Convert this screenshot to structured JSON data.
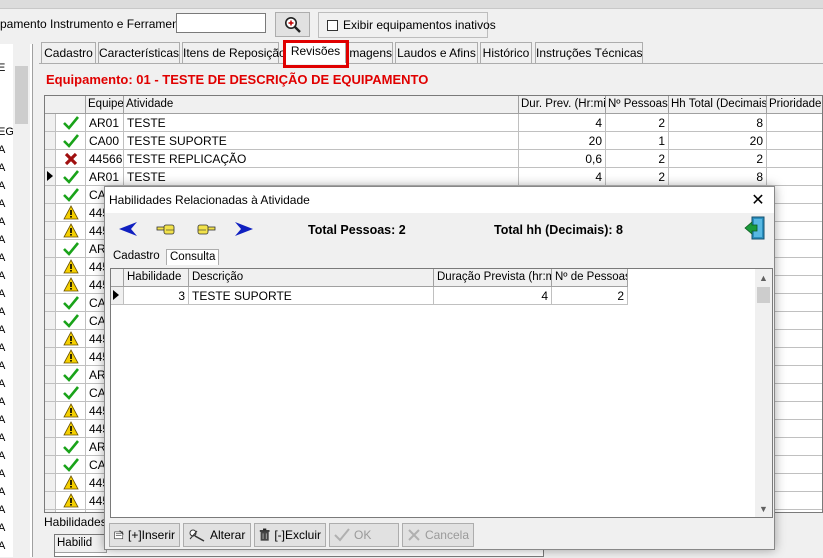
{
  "toolbar": {
    "label": "pamento Instrumento e Ferramenta",
    "search_value": "",
    "inactive_label": "Exibir equipamentos inativos",
    "inactive_checked": false
  },
  "left_tree": {
    "top_letter": "E",
    "letter_eg": "EG",
    "row_letter": "A"
  },
  "tabs": [
    {
      "label": "Cadastro",
      "active": false
    },
    {
      "label": "Características",
      "active": false
    },
    {
      "label": "Itens de Reposição",
      "active": false
    },
    {
      "label": "Revisões",
      "active": true
    },
    {
      "label": "Imagens",
      "active": false
    },
    {
      "label": "Laudos e Afins",
      "active": false
    },
    {
      "label": "Histórico",
      "active": false
    },
    {
      "label": "Instruções Técnicas",
      "active": false
    }
  ],
  "equipment_title": "Equipamento: 01 - TESTE DE DESCRIÇÃO DE EQUIPAMENTO",
  "main_grid": {
    "columns": [
      "Equipe",
      "Atividade",
      "Dur. Prev. (Hr:mi)",
      "Nº Pessoas",
      "Hh Total (Decimais)",
      "Prioridade"
    ],
    "rows": [
      {
        "status": "ok",
        "equipe": "AR01",
        "atividade": "TESTE",
        "dur": "4",
        "pessoas": "2",
        "hh": "8",
        "prioridade": ""
      },
      {
        "status": "ok",
        "equipe": "CA00",
        "atividade": "TESTE SUPORTE",
        "dur": "20",
        "pessoas": "1",
        "hh": "20",
        "prioridade": ""
      },
      {
        "status": "error",
        "equipe": "44566",
        "atividade": "TESTE REPLICAÇÃO",
        "dur": "0,6",
        "pessoas": "2",
        "hh": "2",
        "prioridade": ""
      },
      {
        "status": "ok",
        "equipe": "AR01",
        "atividade": "TESTE",
        "dur": "4",
        "pessoas": "2",
        "hh": "8",
        "prioridade": "",
        "current": true
      },
      {
        "status": "ok",
        "equipe": "CA(",
        "atividade": "",
        "dur": "",
        "pessoas": "",
        "hh": "",
        "prioridade": ""
      },
      {
        "status": "warn",
        "equipe": "445",
        "atividade": "",
        "dur": "",
        "pessoas": "",
        "hh": "",
        "prioridade": ""
      },
      {
        "status": "warn",
        "equipe": "445",
        "atividade": "",
        "dur": "",
        "pessoas": "",
        "hh": "",
        "prioridade": ""
      },
      {
        "status": "ok",
        "equipe": "AR(",
        "atividade": "",
        "dur": "",
        "pessoas": "",
        "hh": "",
        "prioridade": ""
      },
      {
        "status": "warn",
        "equipe": "445",
        "atividade": "",
        "dur": "",
        "pessoas": "",
        "hh": "",
        "prioridade": ""
      },
      {
        "status": "warn",
        "equipe": "445",
        "atividade": "",
        "dur": "",
        "pessoas": "",
        "hh": "",
        "prioridade": ""
      },
      {
        "status": "ok",
        "equipe": "CA(",
        "atividade": "",
        "dur": "",
        "pessoas": "",
        "hh": "",
        "prioridade": ""
      },
      {
        "status": "ok",
        "equipe": "CA(",
        "atividade": "",
        "dur": "",
        "pessoas": "",
        "hh": "",
        "prioridade": ""
      },
      {
        "status": "warn",
        "equipe": "445",
        "atividade": "",
        "dur": "",
        "pessoas": "",
        "hh": "",
        "prioridade": ""
      },
      {
        "status": "warn",
        "equipe": "445",
        "atividade": "",
        "dur": "",
        "pessoas": "",
        "hh": "",
        "prioridade": ""
      },
      {
        "status": "ok",
        "equipe": "AR(",
        "atividade": "",
        "dur": "",
        "pessoas": "",
        "hh": "",
        "prioridade": ""
      },
      {
        "status": "ok",
        "equipe": "CA(",
        "atividade": "",
        "dur": "",
        "pessoas": "",
        "hh": "",
        "prioridade": ""
      },
      {
        "status": "warn",
        "equipe": "445",
        "atividade": "",
        "dur": "",
        "pessoas": "",
        "hh": "",
        "prioridade": ""
      },
      {
        "status": "warn",
        "equipe": "445",
        "atividade": "",
        "dur": "",
        "pessoas": "",
        "hh": "",
        "prioridade": ""
      },
      {
        "status": "ok",
        "equipe": "AR(",
        "atividade": "",
        "dur": "",
        "pessoas": "",
        "hh": "",
        "prioridade": ""
      },
      {
        "status": "ok",
        "equipe": "CA(",
        "atividade": "",
        "dur": "",
        "pessoas": "",
        "hh": "",
        "prioridade": ""
      },
      {
        "status": "warn",
        "equipe": "445",
        "atividade": "",
        "dur": "",
        "pessoas": "",
        "hh": "",
        "prioridade": ""
      },
      {
        "status": "warn",
        "equipe": "445",
        "atividade": "",
        "dur": "",
        "pessoas": "",
        "hh": "",
        "prioridade": ""
      },
      {
        "status": "ok",
        "equipe": "AR(",
        "atividade": "",
        "dur": "",
        "pessoas": "",
        "hh": "",
        "prioridade": ""
      }
    ]
  },
  "bottom": {
    "tab_label": "Habilidades",
    "subgrid_header": "Habilid"
  },
  "dialog": {
    "title": "Habilidades Relacionadas à Atividade",
    "total_pessoas": "Total Pessoas: 2",
    "total_hh": "Total hh (Decimais): 8",
    "tabs": [
      {
        "label": "Cadastro",
        "active": false
      },
      {
        "label": "Consulta",
        "active": true
      }
    ],
    "columns": [
      "Habilidade",
      "Descrição",
      "Duração Prevista (hr:mi)",
      "Nº de Pessoas"
    ],
    "rows": [
      {
        "habilidade": "3",
        "descricao": "TESTE SUPORTE",
        "duracao": "4",
        "pessoas": "2"
      }
    ],
    "buttons": [
      {
        "label": "[+]Inserir",
        "icon": "insert-icon",
        "enabled": true
      },
      {
        "label": "Alterar",
        "icon": "edit-icon",
        "enabled": true
      },
      {
        "label": "[-]Excluir",
        "icon": "trash-icon",
        "enabled": true
      },
      {
        "label": "OK",
        "icon": "check-icon",
        "enabled": false
      },
      {
        "label": "Cancela",
        "icon": "x-icon",
        "enabled": false
      }
    ]
  },
  "colors": {
    "accent_red": "#e00000",
    "ok_green": "#1aa31a",
    "warn_yellow": "#f5d000",
    "nav_blue": "#1020c0"
  }
}
